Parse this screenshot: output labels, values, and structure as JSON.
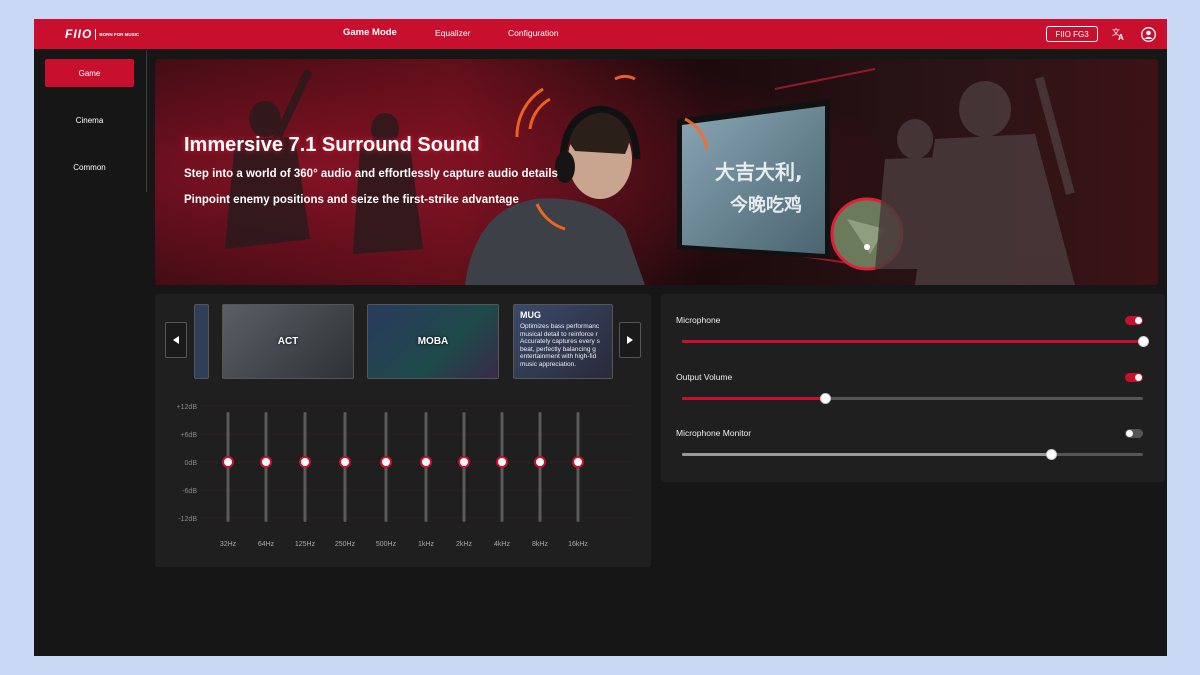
{
  "app": {
    "logo": {
      "mark": "FIIO",
      "tagline": "BORN FOR MUSIC"
    },
    "nav": [
      {
        "label": "Game Mode",
        "active": true
      },
      {
        "label": "Equalizer",
        "active": false
      },
      {
        "label": "Configuration",
        "active": false
      }
    ],
    "device": "FIIO FG3",
    "translate_icon": "translate-icon",
    "account_icon": "account-icon"
  },
  "sidebar": {
    "items": [
      {
        "label": "Game",
        "active": true
      },
      {
        "label": "Cinema",
        "active": false
      },
      {
        "label": "Common",
        "active": false
      }
    ]
  },
  "banner": {
    "title": "Immersive 7.1 Surround Sound",
    "line1": "Step into a world of 360° audio and effortlessly capture audio details",
    "line2": "Pinpoint enemy positions and seize the first-strike advantage",
    "screen_text": "大吉大利,\n今晚吃鸡"
  },
  "presets": {
    "cards": [
      {
        "label": "ACT"
      },
      {
        "label": "MOBA"
      },
      {
        "label": "MUG",
        "description": "Optimizes bass performance and musical detail to reinforce rhythm. Accurately captures every subtle beat, perfectly balancing game entertainment with high-fidelity music appreciation."
      }
    ],
    "mug_desc_visible": "Optimizes bass performanc\nmusical detail to reinforce r\nAccurately captures every s\nbeat, perfectly balancing g\nentertainment with high-fid\nmusic appreciation."
  },
  "equalizer": {
    "db_labels": [
      "+12dB",
      "+6dB",
      "0dB",
      "-6dB",
      "-12dB"
    ],
    "bands": [
      {
        "freq": "32Hz",
        "gain_db": 0
      },
      {
        "freq": "64Hz",
        "gain_db": 0
      },
      {
        "freq": "125Hz",
        "gain_db": 0
      },
      {
        "freq": "250Hz",
        "gain_db": 0
      },
      {
        "freq": "500Hz",
        "gain_db": 0
      },
      {
        "freq": "1kHz",
        "gain_db": 0
      },
      {
        "freq": "2kHz",
        "gain_db": 0
      },
      {
        "freq": "4kHz",
        "gain_db": 0
      },
      {
        "freq": "8kHz",
        "gain_db": 0
      },
      {
        "freq": "16kHz",
        "gain_db": 0
      }
    ],
    "range_db": [
      -12,
      12
    ]
  },
  "volume": {
    "controls": [
      {
        "label": "Microphone",
        "enabled": true,
        "level": 1.0
      },
      {
        "label": "Output Volume",
        "enabled": true,
        "level": 0.31
      },
      {
        "label": "Microphone Monitor",
        "enabled": false,
        "level": 0.8
      }
    ]
  },
  "colors": {
    "accent": "#c8102e",
    "background": "#161616",
    "panel": "#1f1f1f",
    "track_inactive": "#555555",
    "track_disabled": "#9a9a9a"
  }
}
